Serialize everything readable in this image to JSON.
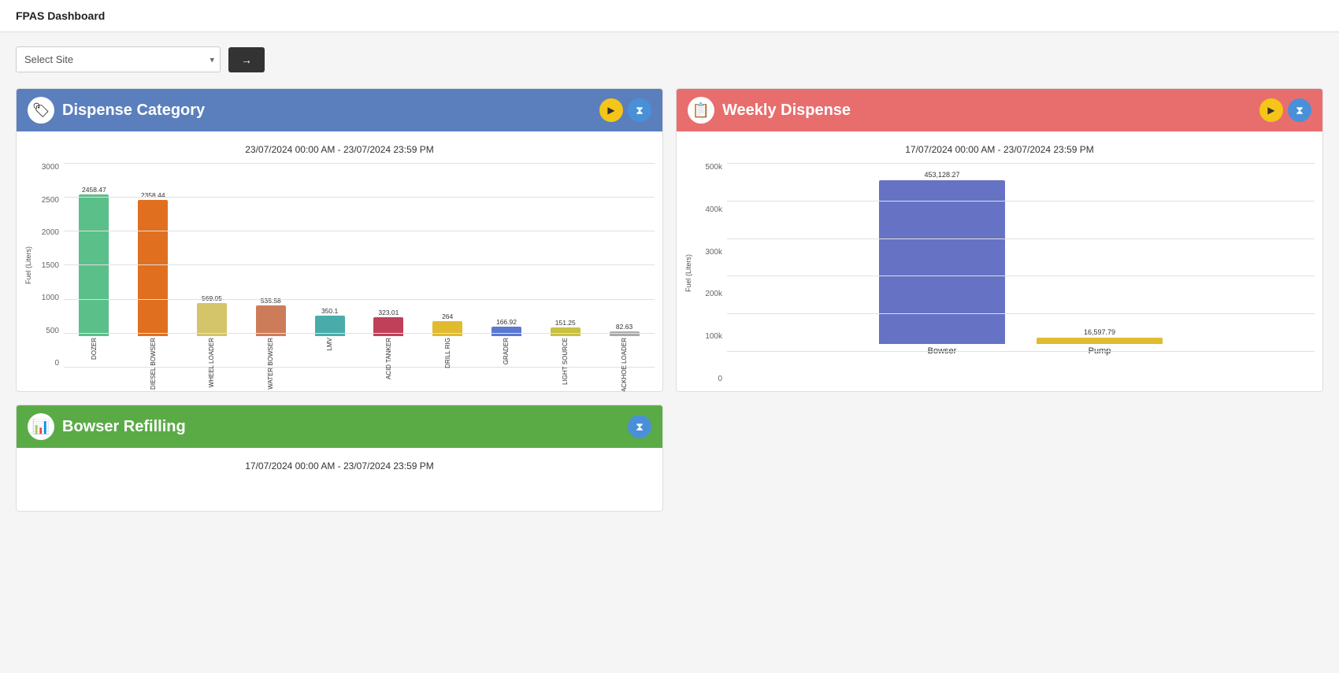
{
  "app": {
    "title": "FPAS Dashboard"
  },
  "controls": {
    "site_select_placeholder": "Select Site",
    "go_button_label": "→",
    "site_options": [
      "Select Site"
    ]
  },
  "dispense_category": {
    "header_title": "Dispense Category",
    "header_icon": "🏷",
    "date_range": "23/07/2024 00:00 AM - 23/07/2024 23:59 PM",
    "y_axis_label": "Fuel (Liters)",
    "y_ticks": [
      "3000",
      "2500",
      "2000",
      "1500",
      "1000",
      "500",
      "0"
    ],
    "bars": [
      {
        "label": "DOZER",
        "value": 2458.47,
        "color": "#5bbf8a",
        "height_pct": 82
      },
      {
        "label": "DIESEL BOWSER",
        "value": 2358.44,
        "color": "#e07020",
        "height_pct": 79
      },
      {
        "label": "WHEEL LOADER",
        "value": 569.05,
        "color": "#d4c46a",
        "height_pct": 19
      },
      {
        "label": "WATER BOWSER",
        "value": 535.58,
        "color": "#cd7c5a",
        "height_pct": 18
      },
      {
        "label": "LMV",
        "value": 350.1,
        "color": "#4aacaa",
        "height_pct": 12
      },
      {
        "label": "ACID TANKER",
        "value": 323.01,
        "color": "#c0405a",
        "height_pct": 11
      },
      {
        "label": "DRILL RIG",
        "value": 264,
        "color": "#e0bb30",
        "height_pct": 9
      },
      {
        "label": "GRADER",
        "value": 166.92,
        "color": "#5a78d0",
        "height_pct": 6
      },
      {
        "label": "LIGHT SOURCE",
        "value": 151.25,
        "color": "#c8c040",
        "height_pct": 5
      },
      {
        "label": "BACKHOE LOADER",
        "value": 82.63,
        "color": "#aaaaaa",
        "height_pct": 3
      }
    ]
  },
  "weekly_dispense": {
    "header_title": "Weekly Dispense",
    "header_icon": "📋",
    "date_range": "17/07/2024 00:00 AM - 23/07/2024 23:59 PM",
    "y_axis_label": "Fuel (Liters)",
    "y_ticks": [
      "500k",
      "400k",
      "300k",
      "200k",
      "100k",
      "0"
    ],
    "bars": [
      {
        "label": "Bowser",
        "value": 453128.27,
        "color": "#6672c4",
        "height_pct": 90
      },
      {
        "label": "Pump",
        "value": 16597.79,
        "color": "#e0bb30",
        "height_pct": 3.3
      }
    ]
  },
  "bowser_refilling": {
    "header_title": "Bowser Refilling",
    "header_icon": "📊",
    "date_range": "17/07/2024 00:00 AM - 23/07/2024 23:59 PM"
  },
  "icons": {
    "play": "▶",
    "filter": "⧗",
    "arrow_right": "→",
    "chevron_down": "▾"
  }
}
